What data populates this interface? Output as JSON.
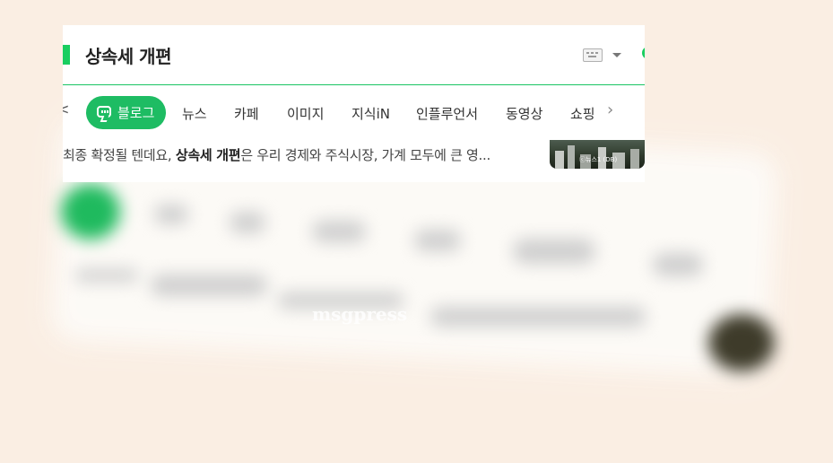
{
  "search": {
    "query": "상속세 개편"
  },
  "tabs": {
    "active": "블로그",
    "items": [
      "뉴스",
      "카페",
      "이미지",
      "지식iN",
      "인플루언서",
      "동영상",
      "쇼핑"
    ],
    "back_glyph": "<",
    "next_glyph": "›"
  },
  "result": {
    "snippet_before": "최종 확정될 텐데요, ",
    "snippet_bold": "상속세 개편",
    "snippet_after": "은 우리 경제와 주식시장, 가계 모두에 큰 영...",
    "thumbnail_caption": "ⓒ뉴스1 (DB)"
  },
  "watermark": "msgpress",
  "colors": {
    "accent_green": "#19ce60",
    "active_tab": "#1ebc63",
    "background": "#faeee3"
  },
  "icons": [
    "keyboard-icon",
    "dropdown-caret-icon",
    "blog-icon",
    "chevron-right-icon",
    "chevron-left-icon"
  ]
}
